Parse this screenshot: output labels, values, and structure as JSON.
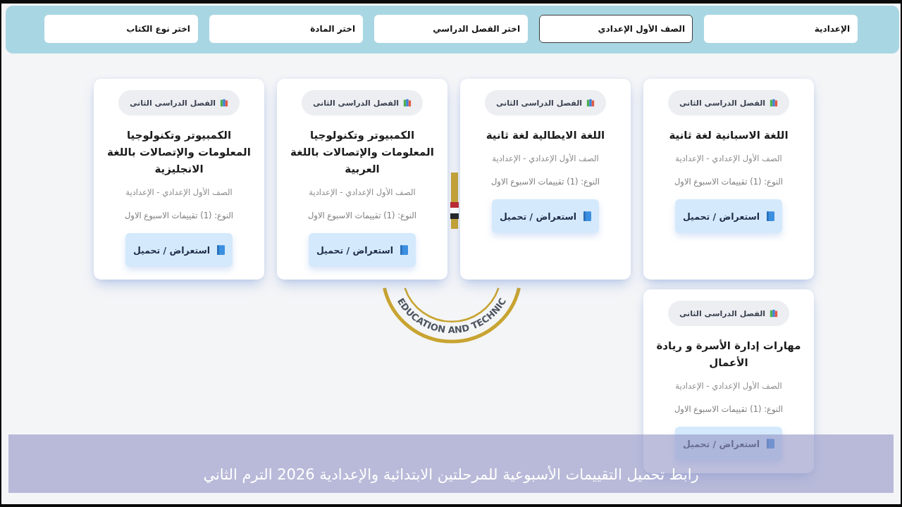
{
  "filters": [
    {
      "value": "الإعدادية",
      "focused": false
    },
    {
      "value": "الصف الأول الإعدادي",
      "focused": true
    },
    {
      "placeholder": "اختر الفصل الدراسي",
      "focused": false
    },
    {
      "placeholder": "اختر المادة",
      "focused": false
    },
    {
      "placeholder": "اختر نوع الكتاب",
      "focused": false
    }
  ],
  "emblem": {
    "text": "EDUCATION AND TECHNIC"
  },
  "cards": [
    {
      "term": "الفصل الدراسى الثانى",
      "title": "اللغة الاسبانية لغة ثانية",
      "grade": "الصف الأول الإعدادي - الإعدادية",
      "type": "النوع: (1) تقييمات الاسبوع الاول",
      "button": "استعراض / تحميل"
    },
    {
      "term": "الفصل الدراسى الثانى",
      "title": "اللغة الايطالية لغة ثانية",
      "grade": "الصف الأول الإعدادي - الإعدادية",
      "type": "النوع: (1) تقييمات الاسبوع الاول",
      "button": "استعراض / تحميل"
    },
    {
      "term": "الفصل الدراسى الثانى",
      "title": "الكمبيوتر وتكنولوجيا المعلومات والإتصالات باللغة العربية",
      "grade": "الصف الأول الإعدادي - الإعدادية",
      "type": "النوع: (1) تقييمات الاسبوع الاول",
      "button": "استعراض / تحميل"
    },
    {
      "term": "الفصل الدراسى الثانى",
      "title": "الكمبيوتر وتكنولوجيا المعلومات والإتصالات باللغة الانجليزية",
      "grade": "الصف الأول الإعدادي - الإعدادية",
      "type": "النوع: (1) تقييمات الاسبوع الاول",
      "button": "استعراض / تحميل"
    },
    {
      "term": "الفصل الدراسى الثانى",
      "title": "مهارات إدارة الأسرة و ريادة الأعمال",
      "grade": "الصف الأول الإعدادي - الإعدادية",
      "type": "النوع: (1) تقييمات الاسبوع الاول",
      "button": "استعراض / تحميل"
    }
  ],
  "caption": "رابط تحميل التقييمات الأسبوعية للمرحلتين الابتدائية والإعدادية 2026 الترم الثاني"
}
